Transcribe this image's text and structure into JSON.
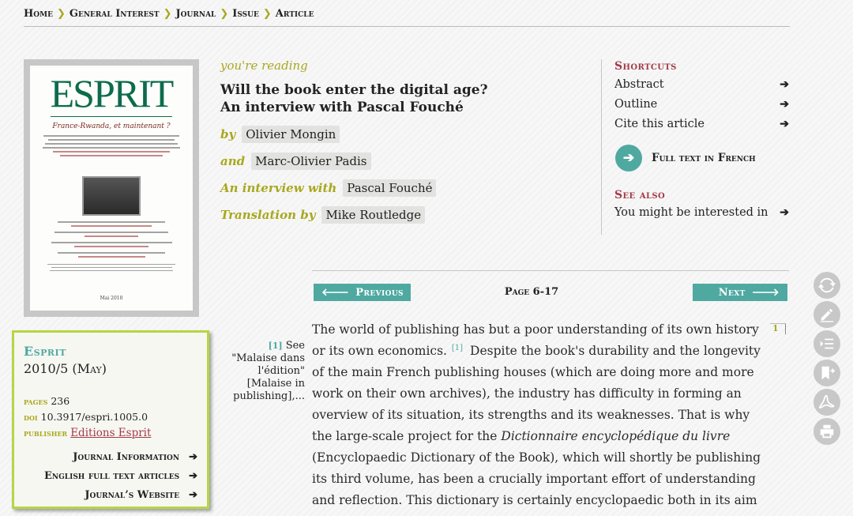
{
  "breadcrumb": {
    "items": [
      "Home",
      "General Interest",
      "Journal",
      "Issue",
      "Article"
    ],
    "separator": "❯"
  },
  "cover": {
    "logo": "ESPRIT",
    "subtitle": "France-Rwanda, et maintenant ?",
    "date": "Mai 2010"
  },
  "infobox": {
    "journal": "Esprit",
    "issue": "2010/5 (May)",
    "pages_label": "pages",
    "pages": "236",
    "doi_label": "doi",
    "doi": "10.3917/espri.1005.0",
    "publisher_label": "publisher",
    "publisher": "Editions Esprit",
    "links": [
      "Journal Information",
      "English full text articles",
      "Journal’s Website"
    ]
  },
  "article": {
    "reading_label": "you're reading",
    "title_line1": "Will the book enter the digital age?",
    "title_line2": "An interview with Pascal Fouché",
    "contributors": [
      {
        "role": "by",
        "name": "Olivier Mongin"
      },
      {
        "role": "and",
        "name": "Marc-Olivier Padis"
      },
      {
        "role": "An interview with",
        "name": "Pascal Fouché"
      },
      {
        "role": "Translation by",
        "name": "Mike Routledge"
      }
    ]
  },
  "shortcuts": {
    "heading": "Shortcuts",
    "items": [
      "Abstract",
      "Outline",
      "Cite this article"
    ],
    "fulltext": "Full text in French",
    "see_also_heading": "See also",
    "see_also_item": "You might be interested in"
  },
  "nav": {
    "previous": "Previous",
    "next": "Next",
    "pages": "Page 6-17"
  },
  "footnote": {
    "number": "[1]",
    "text": "See \"Malaise dans l'édition\" [Malaise in publishing],..."
  },
  "body": {
    "para_number": "1",
    "text1": "The world of publishing has but a poor understanding of its own history or its own economics.",
    "ref": "[1]",
    "text2": "Despite the book's durability and the longevity of the main French publishing houses (which are doing more and more work on their own archives), the industry has difficulty in forming an overview of its situation, its strengths and its weaknesses. That is why the large-scale project for the",
    "italic": "Dictionnaire encyclopédique du livre",
    "text3": "(Encyclopaedic Dictionary of the Book), which will shortly be publishing its third volume, has been a crucially important effort of understanding and reflection. This dictionary is certainly encyclopaedic both in its aim of speaking of the world of the book as a whole, and in the work that has"
  },
  "colors": {
    "teal": "#4fa9a1",
    "olive": "#a8a81e",
    "burgundy": "#a23a47",
    "lime_border": "#b5d645"
  },
  "tools": [
    "refresh-icon",
    "annotate-icon",
    "outline-icon",
    "bookmark-add-icon",
    "pdf-icon",
    "print-icon"
  ]
}
